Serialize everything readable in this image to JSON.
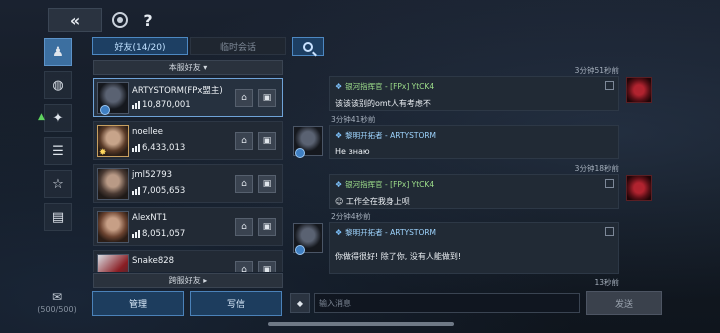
{
  "topbar": {
    "back": "«",
    "help": "?"
  },
  "tabs": {
    "friends": "好友(14/20)",
    "temp_chat": "临时会话"
  },
  "sections": {
    "local": "本服好友 ▾",
    "cross": "跨服好友 ▸"
  },
  "friends": [
    {
      "name": "ARTYSTORM(FPx盟主)",
      "power": "10,870,001"
    },
    {
      "name": "noellee",
      "power": "6,433,013"
    },
    {
      "name": "jml52793",
      "power": "7,005,653"
    },
    {
      "name": "AlexNT1",
      "power": "8,051,057"
    },
    {
      "name": "Snake828",
      "power": ""
    }
  ],
  "buttons": {
    "manage": "管理",
    "write": "写信",
    "send": "发送"
  },
  "mail": {
    "count": "(500/500)"
  },
  "input": {
    "placeholder": "输入消息"
  },
  "messages": [
    {
      "time": "3分钟51秒前",
      "sender": "银河指挥官 - [FPx] YtCK4",
      "text": "该该该别的omt人有考虑不"
    },
    {
      "time": "3分钟41秒前",
      "sender": "黎明开拓者 - ARTYSTORM",
      "text": "Не знаю"
    },
    {
      "time": "3分钟18秒前",
      "sender": "银河指挥官 - [FPx] YtCK4",
      "text": "工作全在我身上呗"
    },
    {
      "time": "2分钟4秒前",
      "sender": "黎明开拓者 - ARTYSTORM",
      "text": "你做得很好! 除了你, 没有人能做到!"
    },
    {
      "time": "13秒前",
      "sender": "",
      "text": ""
    }
  ],
  "colors": {
    "accent": "#4d88c2",
    "ally_green": "#9fe08c",
    "name_blue": "#9fd5ff"
  }
}
